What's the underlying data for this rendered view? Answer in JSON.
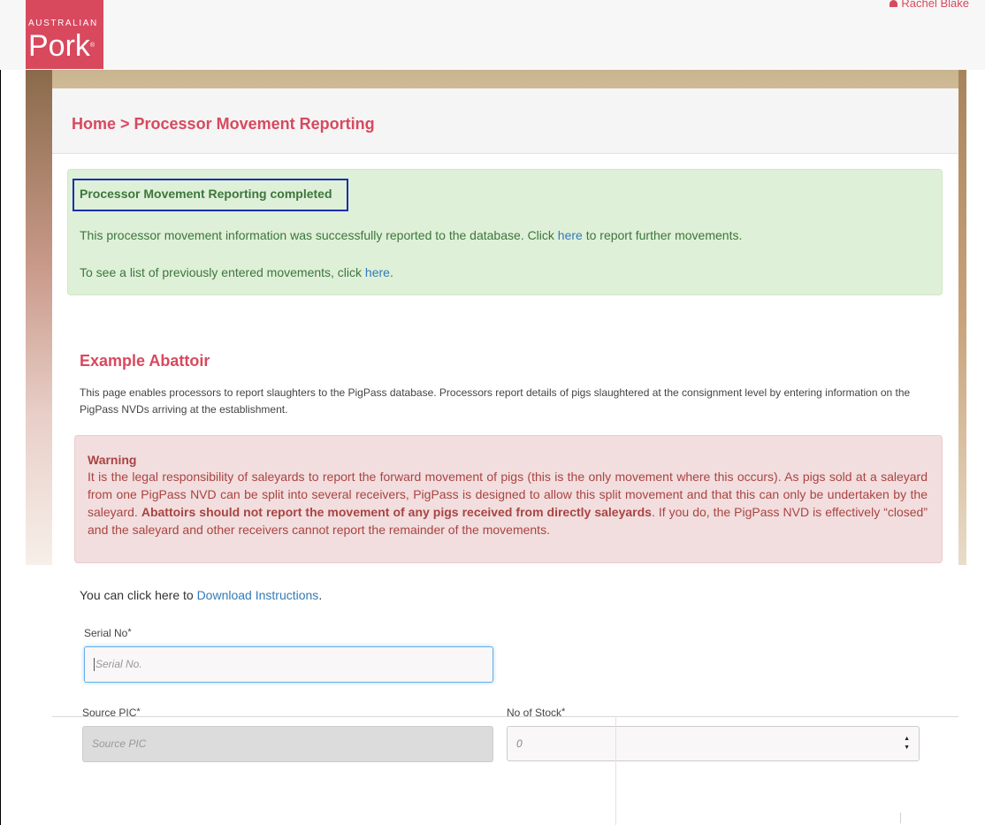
{
  "brand": {
    "line1": "AUSTRALIAN",
    "line2": "Pork",
    "reg": "®"
  },
  "user": {
    "name": "Rachel Blake"
  },
  "breadcrumb": "Home > Processor Movement Reporting",
  "success": {
    "title": "Processor Movement Reporting completed",
    "msg_before": "This processor movement information was successfully reported to the database. Click ",
    "msg_link": "here",
    "msg_after": " to report further movements.",
    "msg2_before": "To see a list of previously entered movements, click ",
    "msg2_link": "here",
    "msg2_after": "."
  },
  "abattoir_title": "Example Abattoir",
  "description": "This page enables processors to report slaughters to the PigPass database. Processors report details of pigs slaughtered at the consignment level by entering information on the PigPass NVDs arriving at the establishment.",
  "warning": {
    "title": "Warning",
    "text_before": "It is the legal responsibility of saleyards to report the forward movement of pigs (this is the only movement where this occurs). As pigs sold at a saleyard from one PigPass NVD can be split into several receivers, PigPass is designed to allow this split movement and that this can only be undertaken by the saleyard. ",
    "text_bold": "Abattoirs should not report the movement of any pigs received from directly saleyards",
    "text_after": ". If you do, the PigPass NVD is effectively “closed” and the saleyard and other receivers cannot report the remainder of the movements."
  },
  "download": {
    "prefix": "You can click here to ",
    "link": "Download Instructions",
    "suffix": "."
  },
  "form": {
    "serial": {
      "label": "Serial No",
      "required": "*",
      "placeholder": "Serial No."
    },
    "source_pic": {
      "label": "Source PIC",
      "required": "*",
      "placeholder": "Source PIC"
    },
    "stock": {
      "label": "No of Stock",
      "required": "*",
      "value": "0"
    },
    "spin_up": "▲",
    "spin_down": "▼"
  },
  "colors": {
    "accent": "#d8495e",
    "success_bg": "#dff0d8",
    "warning_bg": "#f2dede",
    "link": "#337ab7"
  }
}
